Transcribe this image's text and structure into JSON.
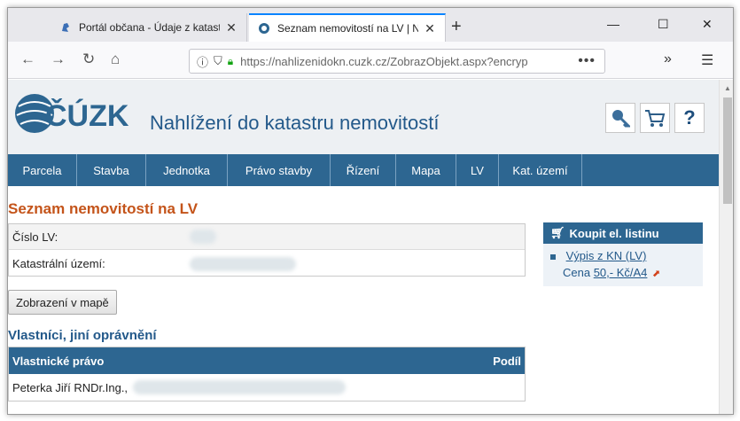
{
  "browser": {
    "tabs": [
      {
        "title": "Portál občana - Údaje z katastru",
        "active": false
      },
      {
        "title": "Seznam nemovitostí na LV | Nah",
        "active": true
      }
    ],
    "new_tab": "+",
    "window_buttons": {
      "minimize": "—",
      "maximize": "☐",
      "close": "✕"
    },
    "toolbar": {
      "back": "←",
      "forward": "→",
      "reload": "↻",
      "home": "⌂",
      "url": "https://nahlizenidokn.cuzk.cz/ZobrazObjekt.aspx?encryp",
      "url_more": "•••",
      "overflow": "»",
      "menu": "☰"
    }
  },
  "header": {
    "logo_text": "ČÚZK",
    "title": "Nahlížení do katastru nemovitostí",
    "buttons": {
      "help": "?"
    }
  },
  "nav": [
    "Parcela",
    "Stavba",
    "Jednotka",
    "Právo stavby",
    "Řízení",
    "Mapa",
    "LV",
    "Kat. území"
  ],
  "main": {
    "heading": "Seznam nemovitostí na LV",
    "lv_rows": [
      {
        "label": "Číslo LV:"
      },
      {
        "label": "Katastrální území:"
      }
    ],
    "map_button": "Zobrazení v mapě",
    "owners_heading": "Vlastníci, jiní oprávnění",
    "owners_table": {
      "col_left": "Vlastnické právo",
      "col_right": "Podíl",
      "row": "Peterka Jiří RNDr.Ing.,"
    }
  },
  "buy_panel": {
    "heading": "Koupit el. listinu",
    "link": "Výpis z KN (LV)",
    "price_label": "Cena",
    "price_value": "50,- Kč/A4"
  },
  "colors": {
    "nav_blue": "#2d6691",
    "title_blue": "#23598a",
    "heading_orange": "#c4541a",
    "header_bg": "#edf0f3"
  }
}
